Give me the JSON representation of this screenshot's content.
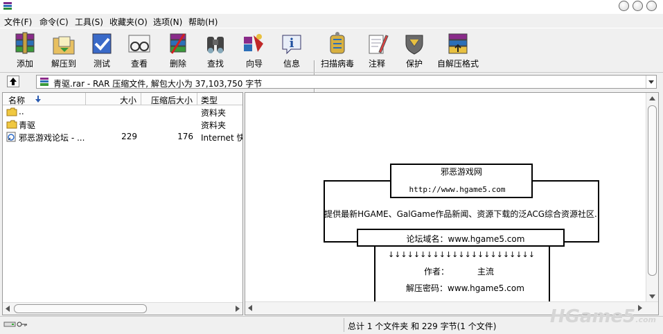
{
  "menu": [
    "文件(F)",
    "命令(C)",
    "工具(S)",
    "收藏夹(O)",
    "选项(N)",
    "帮助(H)"
  ],
  "toolbar": {
    "add": "添加",
    "extract": "解压到",
    "test": "测试",
    "view": "查看",
    "delete": "删除",
    "find": "查找",
    "wizard": "向导",
    "info": "信息",
    "scan": "扫描病毒",
    "comment": "注释",
    "protect": "保护",
    "sfx": "自解压格式"
  },
  "address": {
    "filename": "青驱",
    "text": ".rar - RAR 压缩文件, 解包大小为 37,103,750 字节"
  },
  "file_list": {
    "columns": [
      "名称",
      "大小",
      "压缩后大小",
      "类型"
    ],
    "rows": [
      {
        "name": "..",
        "size": "",
        "packed": "",
        "type": "资料夹"
      },
      {
        "name": "青驱",
        "size": "",
        "packed": "",
        "type": "资料夹"
      },
      {
        "name": "邪恶游戏论坛 - ...",
        "size": "229",
        "packed": "176",
        "type": "Internet 快捷"
      }
    ]
  },
  "comment": {
    "site_name": "邪恶游戏网",
    "site_url": "http://www.hgame5.com",
    "description": "提供最新HGAME、GalGame作品新闻、资源下载的泛ACG综合资源社区.",
    "forum_label": "论坛域名：www.hgame5.com",
    "arrows": "↓↓↓↓↓↓↓↓↓↓↓↓↓↓↓↓↓↓↓↓↓↓↓",
    "author_label": "作者：",
    "author_value": "主流",
    "password_label": "解压密码：www.hgame5.com"
  },
  "status": {
    "text": "总计 1 个文件夹 和 229 字节(1 个文件)"
  },
  "watermark": {
    "main": "HGame5",
    "suffix": ".com"
  }
}
